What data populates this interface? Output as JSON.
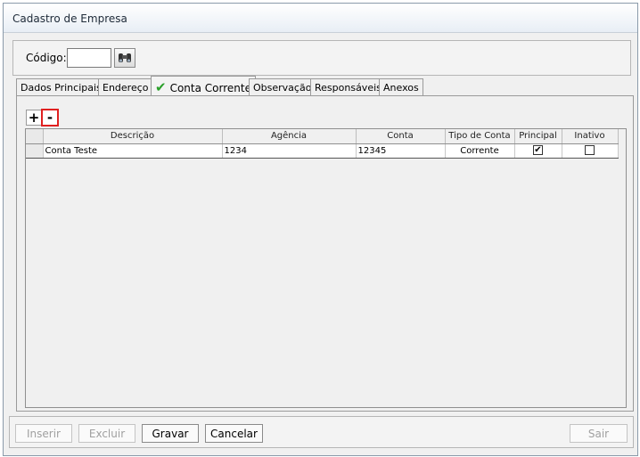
{
  "window": {
    "title": "Cadastro de Empresa"
  },
  "header": {
    "codigo_label": "Código:",
    "codigo_value": ""
  },
  "tabs": [
    {
      "label": "Dados Principais",
      "active": false
    },
    {
      "label": "Endereço",
      "active": false
    },
    {
      "label": "Conta Corrente",
      "active": true
    },
    {
      "label": "Observação",
      "active": false
    },
    {
      "label": "Responsáveis",
      "active": false
    },
    {
      "label": "Anexos",
      "active": false
    }
  ],
  "grid_toolbar": {
    "add_label": "+",
    "remove_label": "-"
  },
  "grid": {
    "columns": [
      "Descrição",
      "Agência",
      "Conta",
      "Tipo de Conta",
      "Principal",
      "Inativo"
    ],
    "rows": [
      {
        "descricao": "Conta Teste",
        "agencia": "1234",
        "conta": "12345",
        "tipo": "Corrente",
        "principal": true,
        "inativo": false
      }
    ]
  },
  "footer": {
    "inserir": "Inserir",
    "excluir": "Excluir",
    "gravar": "Gravar",
    "cancelar": "Cancelar",
    "sair": "Sair"
  },
  "colors": {
    "remove_highlight": "#e02020",
    "check_mark": "#2aa02a"
  },
  "icons": {
    "search": "binoculars-icon",
    "tab_status": "checkmark-icon"
  }
}
